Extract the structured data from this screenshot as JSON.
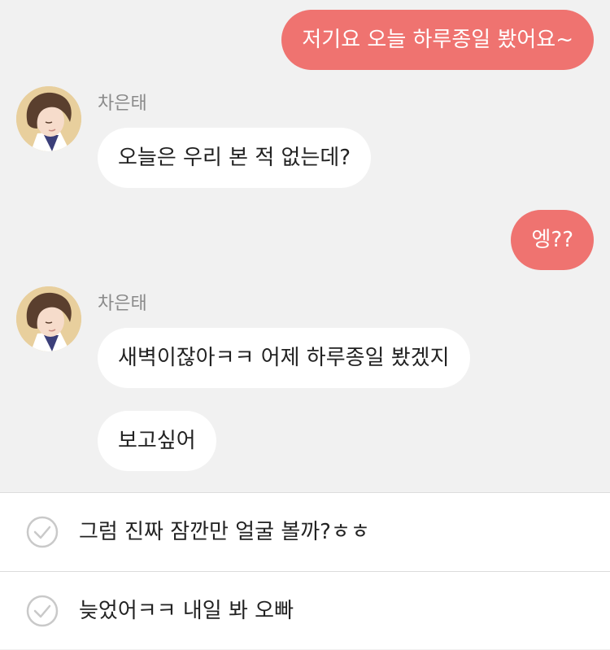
{
  "messages": [
    {
      "direction": "out",
      "text": "저기요 오늘 하루종일 봤어요~"
    },
    {
      "direction": "in",
      "sender": "차은태",
      "text": "오늘은 우리 본 적 없는데?"
    },
    {
      "direction": "out",
      "text": "엥??"
    },
    {
      "direction": "in",
      "sender": "차은태",
      "text": "새벽이잖아ㅋㅋ 어제 하루종일 봤겠지"
    },
    {
      "direction": "in",
      "text": "보고싶어"
    }
  ],
  "choices": [
    {
      "text": "그럼 진짜 잠깐만 얼굴 볼까?ㅎㅎ",
      "icon": "check-circle-icon"
    },
    {
      "text": "늦었어ㅋㅋ 내일 봐 오빠",
      "icon": "check-circle-icon"
    }
  ],
  "colors": {
    "outgoing_bubble": "#ef7370",
    "incoming_bubble": "#ffffff",
    "background": "#f1f1f1"
  }
}
